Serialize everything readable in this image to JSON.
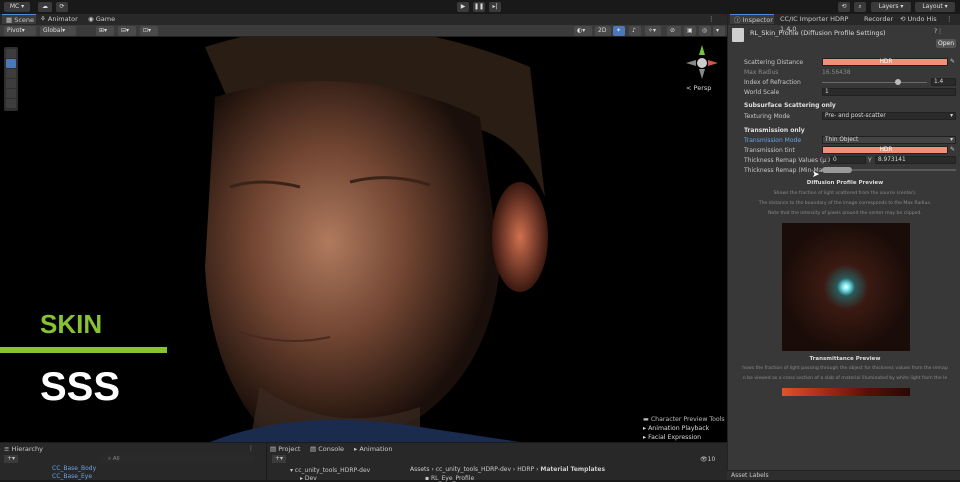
{
  "topbar": {
    "account": "MC",
    "play_icon": "play-icon",
    "pause_icon": "pause-icon",
    "step_icon": "step-icon",
    "layers": "Layers",
    "layout": "Layout"
  },
  "scene_tabs": {
    "scene": "Scene",
    "animator": "Animator",
    "game": "Game"
  },
  "scene_toolbar": {
    "pivot": "Pivot",
    "global": "Global",
    "mode_2d": "2D"
  },
  "viewport": {
    "persp": "< Persp",
    "overlay_skin": "SKIN",
    "overlay_sss": "SSS",
    "skin_color": "#86c232",
    "preview_tools": [
      "Character Preview Tools",
      "Animation Playback",
      "Facial Expression"
    ]
  },
  "inspector": {
    "tabs": [
      "Inspector",
      "CC/IC Importer HDRP 1.4.0",
      "Recorder",
      "Undo His"
    ],
    "title": "RL_Skin_Profile (Diffusion Profile Settings)",
    "open_button": "Open",
    "scattering_distance": "Scattering Distance",
    "scattering_hdr": "HDR",
    "scattering_color": "#f0907a",
    "max_radius_label": "Max Radius",
    "max_radius_value": "16.56438",
    "ior_label": "Index of Refraction",
    "ior_value": "1.4",
    "ior_slider": 0.72,
    "world_scale_label": "World Scale",
    "world_scale_value": "1",
    "sss_section": "Subsurface Scattering only",
    "texturing_mode_label": "Texturing Mode",
    "texturing_mode_value": "Pre- and post-scatter",
    "transmission_section": "Transmission only",
    "transmission_mode_label": "Transmission Mode",
    "transmission_mode_value": "Thin Object",
    "transmission_tint_label": "Transmission tint",
    "transmission_tint_hdr": "HDR",
    "thickness_remap_values_label": "Thickness Remap Values (µ X",
    "thickness_x": "0",
    "thickness_y_label": "Y",
    "thickness_y": "8.973141",
    "thickness_remap_label": "Thickness Remap (Min-Ma",
    "diffusion_preview_title": "Diffusion Profile Preview",
    "diffusion_notes": [
      "Shows the fraction of light scattered from the source (center).",
      "The distance to the boundary of the image corresponds to the Max Radius.",
      "Note that the intensity of pixels around the center may be clipped."
    ],
    "transmittance_title": "Transmittance Preview",
    "transmittance_notes": [
      "hows the fraction of light passing through the object for thickness values from the remap",
      "n be viewed as a cross section of a slab of material illuminated by white light from the le"
    ],
    "asset_labels": "Asset Labels"
  },
  "bottom": {
    "hierarchy": "Hierarchy",
    "project": "Project",
    "console": "Console",
    "animation": "Animation",
    "search_placeholder": "All",
    "hierarchy_items": [
      "CC_Base_Body",
      "CC_Base_Eye"
    ],
    "project_folder": "cc_unity_tools_HDRP-dev",
    "project_sub": "Dev",
    "breadcrumb": [
      "Assets",
      "cc_unity_tools_HDRP-dev",
      "HDRP",
      "Material Templates"
    ],
    "project_file": "RL_Eye_Profile",
    "count": "10"
  }
}
